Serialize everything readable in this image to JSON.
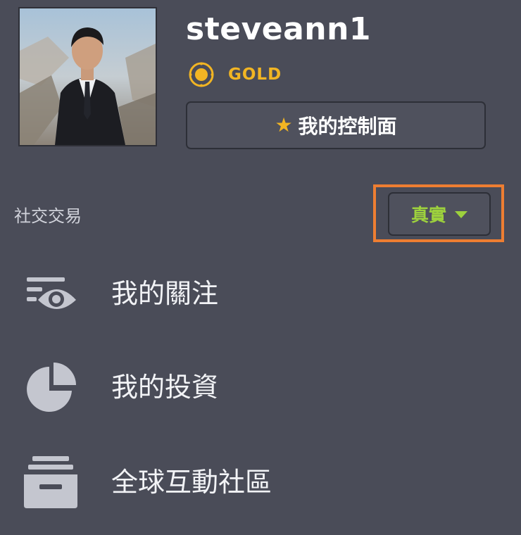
{
  "profile": {
    "username": "steveann1",
    "tier_label": "GOLD",
    "dashboard_label": "我的控制面",
    "avatar_alt": "user-avatar"
  },
  "social": {
    "section_label": "社交交易",
    "mode_label": "真實"
  },
  "menu": {
    "items": [
      {
        "label": "我的關注",
        "icon": "eye-watch-icon"
      },
      {
        "label": "我的投資",
        "icon": "pie-chart-icon"
      },
      {
        "label": "全球互動社區",
        "icon": "community-tray-icon"
      }
    ]
  },
  "colors": {
    "background": "#4a4c58",
    "gold": "#f2b523",
    "mode_green": "#9dd13d",
    "highlight_orange": "#ee7e32",
    "icon_gray": "#c4c6cf"
  }
}
